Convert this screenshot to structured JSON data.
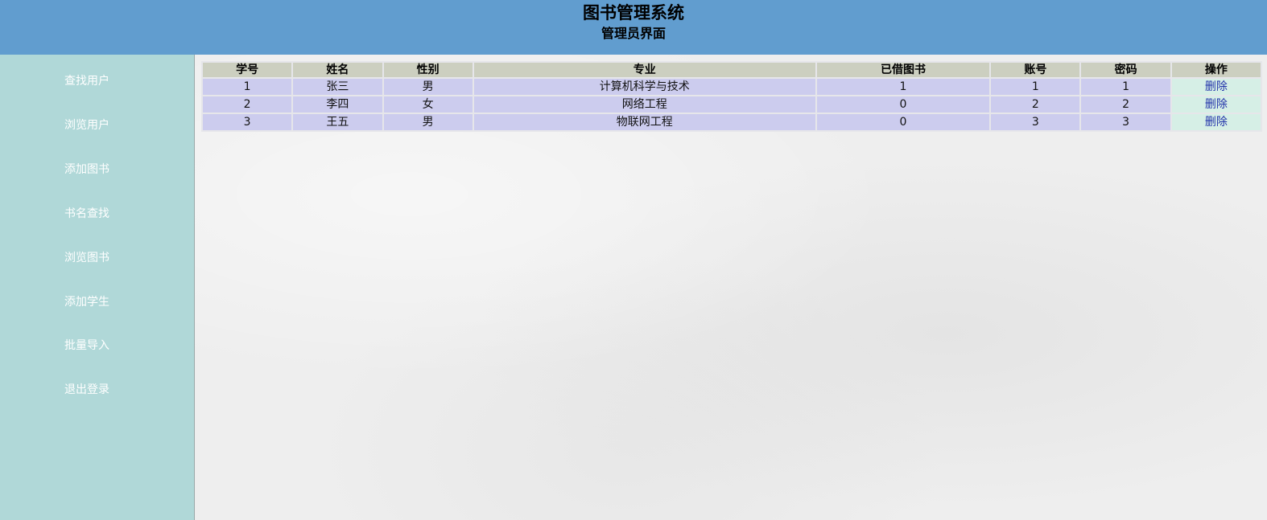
{
  "header": {
    "title": "图书管理系统",
    "subtitle": "管理员界面"
  },
  "sidebar": {
    "items": [
      {
        "label": "查找用户"
      },
      {
        "label": "浏览用户"
      },
      {
        "label": "添加图书"
      },
      {
        "label": "书名查找"
      },
      {
        "label": "浏览图书"
      },
      {
        "label": "添加学生"
      },
      {
        "label": "批量导入"
      },
      {
        "label": "退出登录"
      }
    ]
  },
  "table": {
    "columns": [
      "学号",
      "姓名",
      "性别",
      "专业",
      "已借图书",
      "账号",
      "密码",
      "操作"
    ],
    "rows": [
      {
        "id": "1",
        "name": "张三",
        "gender": "男",
        "major": "计算机科学与技术",
        "borrowed": "1",
        "account": "1",
        "password": "1",
        "action": "删除"
      },
      {
        "id": "2",
        "name": "李四",
        "gender": "女",
        "major": "网络工程",
        "borrowed": "0",
        "account": "2",
        "password": "2",
        "action": "删除"
      },
      {
        "id": "3",
        "name": "王五",
        "gender": "男",
        "major": "物联网工程",
        "borrowed": "0",
        "account": "3",
        "password": "3",
        "action": "删除"
      }
    ]
  },
  "colors": {
    "header_bg": "#619dcf",
    "sidebar_bg": "#b0d8d8",
    "table_header_bg": "#cccfc0",
    "table_row_bg": "#ccccee",
    "action_cell_bg": "#d6efe6",
    "link_color": "#2233aa"
  }
}
